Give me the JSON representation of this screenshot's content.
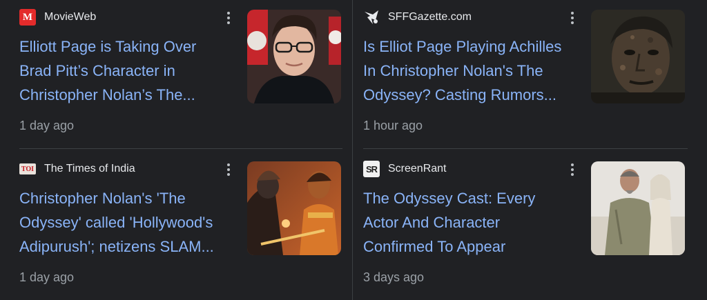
{
  "articles": [
    {
      "source": "MovieWeb",
      "favicon_letter": "M",
      "headline_lines": [
        "Elliott Page is Taking Over",
        "Brad Pitt’s Character in",
        "Christopher Nolan’s The..."
      ],
      "time": "1 day ago",
      "thumbnail_icon": "portrait-photo-icon"
    },
    {
      "source": "SFFGazette.com",
      "favicon_letter": "",
      "headline_lines": [
        "Is Elliot Page Playing Achilles",
        "In Christopher Nolan's The",
        "Odyssey? Casting Rumors..."
      ],
      "time": "1 hour ago",
      "thumbnail_icon": "muddy-face-photo-icon"
    },
    {
      "source": "The Times of India",
      "favicon_letter": "TOI",
      "headline_lines": [
        "Christopher Nolan's 'The",
        "Odyssey' called 'Hollywood's",
        "Adipurush'; netizens SLAM..."
      ],
      "time": "1 day ago",
      "thumbnail_icon": "warriors-photo-icon"
    },
    {
      "source": "ScreenRant",
      "favicon_letter": "SR",
      "headline_lines": [
        "The Odyssey Cast: Every",
        "Actor And Character",
        "Confirmed To Appear"
      ],
      "time": "3 days ago",
      "thumbnail_icon": "two-people-photo-icon"
    }
  ],
  "colors": {
    "background": "#202124",
    "headline": "#8ab4f8",
    "source": "#e8eaed",
    "time": "#9aa0a6",
    "divider": "#3c4043"
  }
}
